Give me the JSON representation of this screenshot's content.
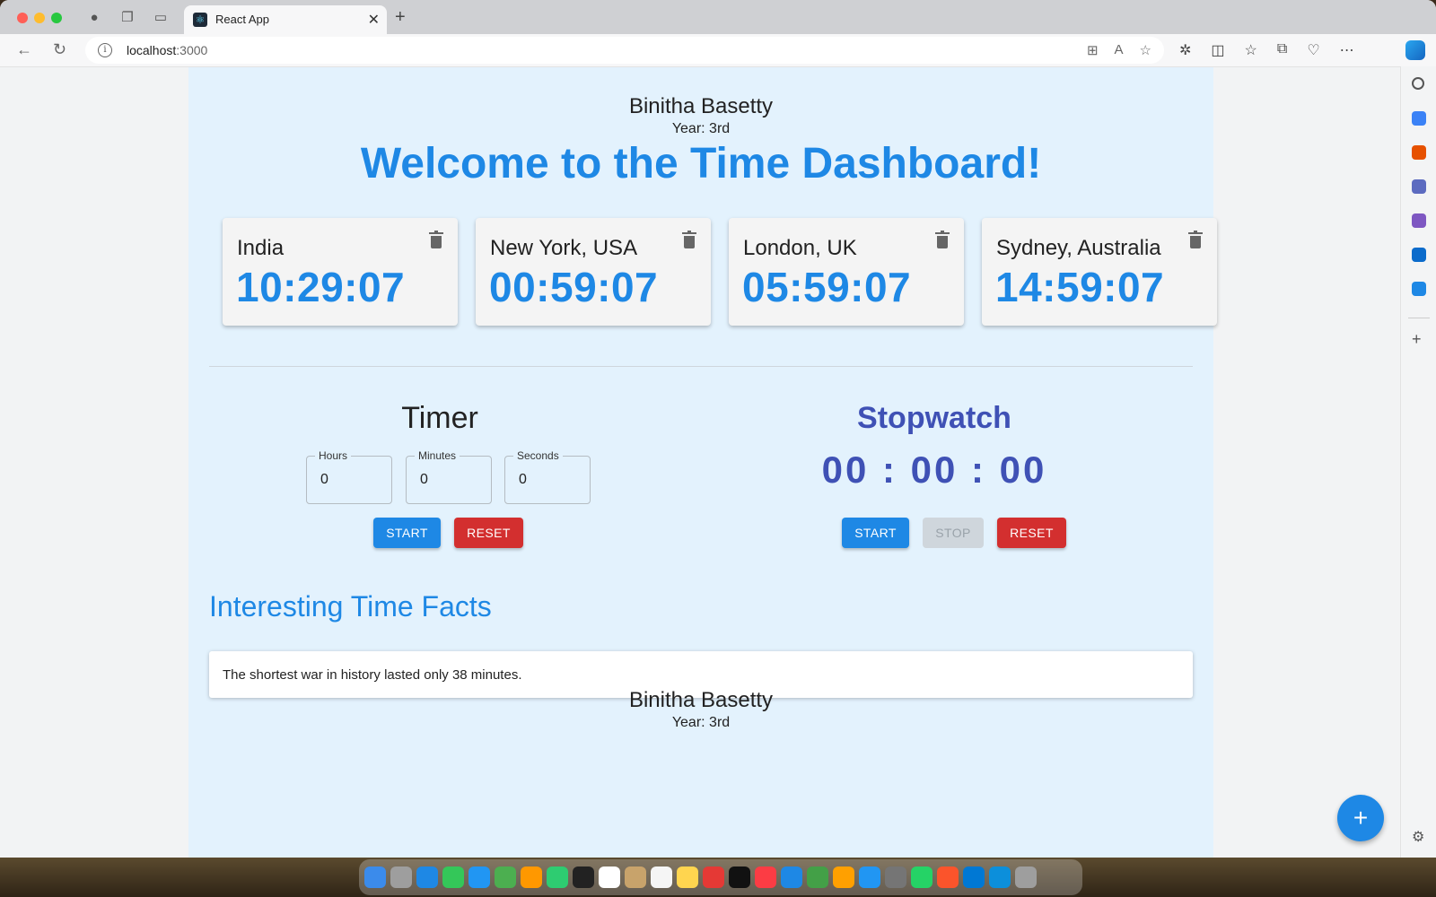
{
  "browser": {
    "tab_title": "React App",
    "tab_close": "✕",
    "new_tab": "+",
    "url_host": "localhost",
    "url_port": ":3000"
  },
  "header": {
    "name": "Binitha Basetty",
    "year": "Year: 3rd",
    "welcome": "Welcome to the Time Dashboard!"
  },
  "clocks": [
    {
      "city": "India",
      "time": "10:29:07"
    },
    {
      "city": "New York, USA",
      "time": "00:59:07"
    },
    {
      "city": "London, UK",
      "time": "05:59:07"
    },
    {
      "city": "Sydney, Australia",
      "time": "14:59:07"
    }
  ],
  "timer": {
    "title": "Timer",
    "hours_label": "Hours",
    "minutes_label": "Minutes",
    "seconds_label": "Seconds",
    "hours_value": "0",
    "minutes_value": "0",
    "seconds_value": "0",
    "start_label": "START",
    "reset_label": "RESET"
  },
  "stopwatch": {
    "title": "Stopwatch",
    "display": "00 : 00 : 00",
    "start_label": "START",
    "stop_label": "STOP",
    "reset_label": "RESET"
  },
  "facts": {
    "title": "Interesting Time Facts",
    "fact": "The shortest war in history lasted only 38 minutes."
  },
  "footer": {
    "name": "Binitha Basetty",
    "year": "Year: 3rd"
  },
  "fab_label": "+",
  "colors": {
    "primary": "#1e88e5",
    "danger": "#d32f2f",
    "indigo": "#3f51b5",
    "page_bg": "#e3f2fd"
  }
}
